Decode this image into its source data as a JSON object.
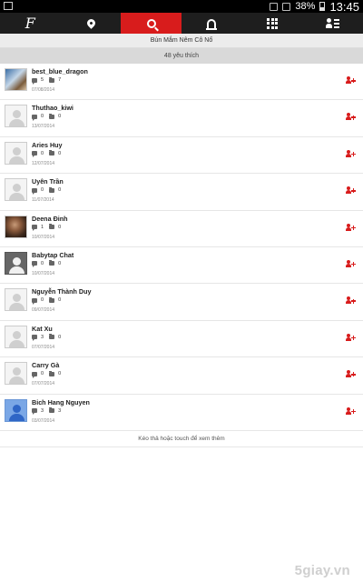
{
  "status_bar": {
    "battery": "38%",
    "time": "13:45"
  },
  "nav": {
    "logo": "F",
    "active_tab": "search"
  },
  "page": {
    "title": "Bún Mắm Nêm Cô Nổ",
    "likes_count": "48 yêu thích"
  },
  "users": [
    {
      "name": "best_blue_dragon",
      "comments": "5",
      "albums": "7",
      "date": "07/08/2014",
      "avatar": "photo1"
    },
    {
      "name": "Thuthao_kiwi",
      "comments": "0",
      "albums": "0",
      "date": "13/07/2014",
      "avatar": "placeholder"
    },
    {
      "name": "Aries Huy",
      "comments": "0",
      "albums": "0",
      "date": "12/07/2014",
      "avatar": "placeholder"
    },
    {
      "name": "Uyên Trần",
      "comments": "0",
      "albums": "0",
      "date": "11/07/2014",
      "avatar": "placeholder"
    },
    {
      "name": "Deena Đinh",
      "comments": "1",
      "albums": "0",
      "date": "10/07/2014",
      "avatar": "photo2"
    },
    {
      "name": "Babytap Chat",
      "comments": "0",
      "albums": "0",
      "date": "10/07/2014",
      "avatar": "dark"
    },
    {
      "name": "Nguyễn  Thành Duy",
      "comments": "0",
      "albums": "0",
      "date": "09/07/2014",
      "avatar": "placeholder"
    },
    {
      "name": "Kat Xu",
      "comments": "3",
      "albums": "0",
      "date": "07/07/2014",
      "avatar": "placeholder"
    },
    {
      "name": "Carry Gà",
      "comments": "0",
      "albums": "0",
      "date": "07/07/2014",
      "avatar": "placeholder"
    },
    {
      "name": "Bich Hang Nguyen",
      "comments": "3",
      "albums": "3",
      "date": "03/07/2014",
      "avatar": "blue"
    }
  ],
  "footer": {
    "load_more": "Kéo thả hoặc touch để xem thêm"
  },
  "watermark": "5giay.vn",
  "colors": {
    "accent": "#d81c1c",
    "navbar": "#1e1e1e"
  },
  "icons": {
    "add_friend": "add-friend-icon",
    "comment": "comment-icon",
    "album": "album-icon"
  }
}
